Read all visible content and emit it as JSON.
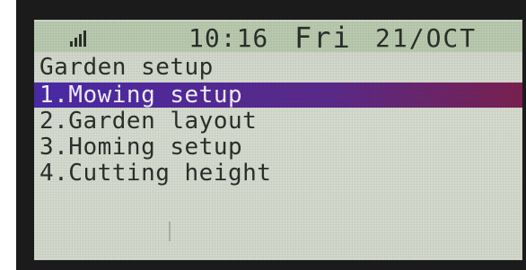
{
  "status": {
    "signal_icon": "signal-bars-icon",
    "time": "10:16",
    "day": "Fri",
    "date": "21/OCT"
  },
  "title": "Garden setup",
  "menu": {
    "selected_index": 0,
    "items": [
      {
        "label": "1.Mowing setup"
      },
      {
        "label": "2.Garden layout"
      },
      {
        "label": "3.Homing setup"
      },
      {
        "label": "4.Cutting height"
      }
    ]
  },
  "colors": {
    "lcd_background": "#d3d8cc",
    "status_bar": "#b9c9ae",
    "highlight": "#4a2aa8",
    "text": "#2a2f2a"
  }
}
